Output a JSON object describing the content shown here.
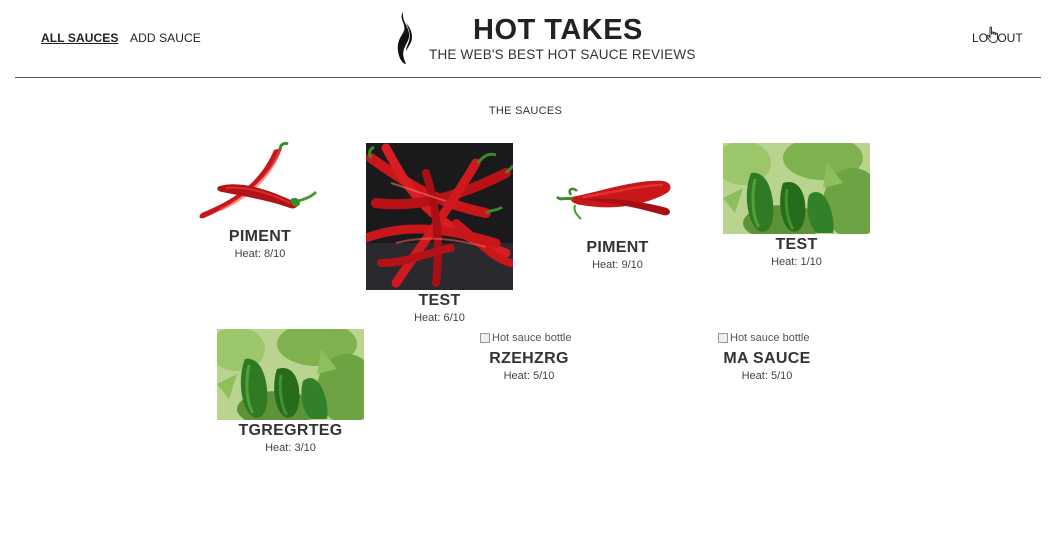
{
  "nav": {
    "all_sauces": "ALL SAUCES",
    "add_sauce": "ADD SAUCE",
    "logout": "LOGOUT"
  },
  "brand": {
    "title": "HOT TAKES",
    "subtitle": "THE WEB'S BEST HOT SAUCE REVIEWS"
  },
  "section_title": "THE SAUCES",
  "sauces": [
    {
      "name": "PIMENT",
      "heat": "Heat: 8/10",
      "image": "red-chili-pair"
    },
    {
      "name": "TEST",
      "heat": "Heat: 6/10",
      "image": "red-chilies-dark"
    },
    {
      "name": "PIMENT",
      "heat": "Heat: 9/10",
      "image": "red-chili-single"
    },
    {
      "name": "TEST",
      "heat": "Heat: 1/10",
      "image": "green-peppers"
    },
    {
      "name": "TGREGRTEG",
      "heat": "Heat: 3/10",
      "image": "green-peppers"
    },
    {
      "name": "RZEHZRG",
      "heat": "Heat: 5/10",
      "image_alt": "Hot sauce bottle"
    },
    {
      "name": "MA SAUCE",
      "heat": "Heat: 5/10",
      "image_alt": "Hot sauce bottle"
    }
  ],
  "colors": {
    "text": "#222222",
    "chili_red": "#c8161b",
    "pepper_green": "#3d8a2a",
    "rule": "#555555"
  }
}
